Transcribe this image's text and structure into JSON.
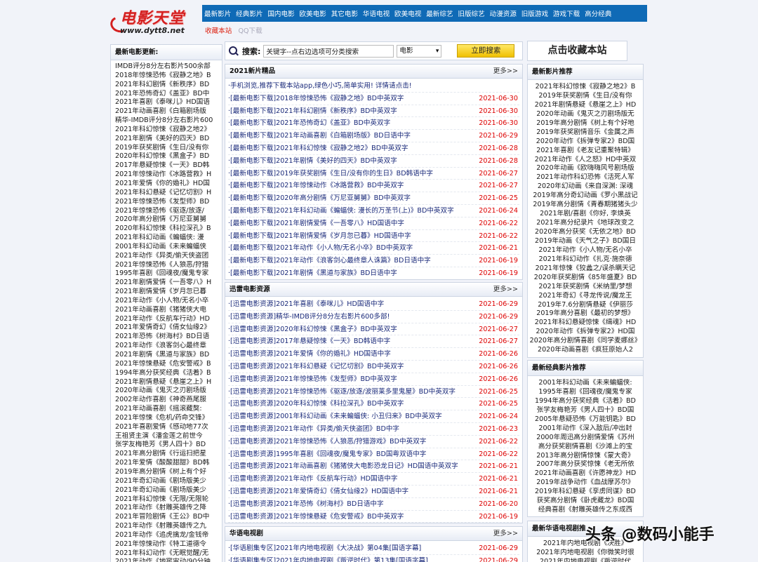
{
  "logo": {
    "cn": "电影天堂",
    "url": "www.dytt8.net"
  },
  "nav": [
    "最新影片",
    "经典影片",
    "国内电影",
    "欧美电影",
    "其它电影",
    "华语电视",
    "欧美电视",
    "最新综艺",
    "旧版综艺",
    "动漫资源",
    "旧版游戏",
    "游戏下载",
    "高分经典"
  ],
  "subnav": {
    "fav": "收藏本站",
    "qq": "QQ下载"
  },
  "left": {
    "title": "最新电影更新:",
    "items": [
      "IMDB评分8分左右影片500余部",
      "2018年惊悚恐怖《寂静之地》B",
      "2021年科幻剧情《新秩序》BD",
      "2021年恐怖奇幻《盖亚》BD中",
      "2021年喜剧《泰咪儿》HD国语",
      "2021年动画喜剧《白箱剧场版",
      "精华-IMDB评分8分左右影片600",
      "2021年科幻惊悚《寂静之地2》",
      "2021年剧情《美好的四天》BD",
      "2019年获奖剧情《生日/没有你",
      "2020年科幻惊悚《黑盒子》BD",
      "2017年悬疑惊悚《一天》BD韩",
      "2021年惊悚动作《冰路营救》H",
      "2021年爱情《你的婚礼》HD国",
      "2021年科幻悬疑《记忆切割》H",
      "2021年惊悚恐怖《发型师》BD",
      "2021年惊悚恐怖《驱逐/放逐/",
      "2020年高分剧情《万尼亚舅舅",
      "2020年科幻惊悚《科拉深孔》B",
      "2021年科幻动画《蝙蝠侠: 漫",
      "2001年科幻动画《未来蝙蝠侠",
      "2021年动作《异类/偷天侠盗团",
      "2021年惊悚恐怖《人狼恶/狩猎",
      "1995年喜剧《回魂夜/魔鬼专家",
      "2021年剧情爱情《一吾零八》H",
      "2021年剧情爱情《岁月忽已暮",
      "2021年动作《小人物/无名小卒",
      "2021年动画喜剧《猪猪侠大电",
      "2021年动作《反航车行动》HD",
      "2021年爱情奇幻《倩女仙缘2》",
      "2021年恐怖《树海村》BD日语",
      "2021年动作《浪客剑心最终章",
      "2021年剧情《黑道与家族》BD",
      "2021年惊悚悬疑《危安警戒》B",
      "1994年高分获奖经典《活着》B",
      "2021年剧情悬疑《悬崖之上》H",
      "2020年动画《鬼灭之刃剧场版",
      "2002年动作喜剧《神奇燕尾服",
      "2021年动画喜剧《摇滚藏獒:",
      "2021年惊悚《危机/药命交锋》",
      "2021年喜剧爱情《感动地77次",
      "王祖贤主演《潘金莲之前世今",
      "张学友梅艳芳《男人四十》BD",
      "2021年高分剧情《行运扫把星",
      "2021年爱情《酸酸甜甜》BD韩",
      "2019年高分剧情《树上有个好",
      "2021年奇幻动画《剧场版美少",
      "2021年奇幻动画《剧场版美少",
      "2021年科幻惊悚《无限/无限轮",
      "2021年动作《射雕英雄传之降",
      "2021年冒险剧情《王公》BD中",
      "2021年动作《射雕英雄传之九",
      "2021年动作《追虎擒龙/金钱帝",
      "2021年惊悚动作《特工道德令",
      "2021年科幻动作《无眠觉醒/无",
      "2021年动作《地窖宙动/90分钟"
    ]
  },
  "search": {
    "label": "搜索:",
    "input": "关键字--点右边选项可分类搜索",
    "select": "电影",
    "button": "立即搜索"
  },
  "fav_button": "点击收藏本站",
  "box1": {
    "title": "2021新片精品",
    "more": "更多>>",
    "notice": "·手机浏览,推荐下载本站app,绿色小巧,简单实用! 详情请点击!",
    "rows": [
      {
        "t": "·[最新电影下载]2018年惊悚恐怖《寂静之地》BD中英双字",
        "d": "2021-06-30"
      },
      {
        "t": "·[最新电影下载]2021年科幻剧情《新秩序》BD中英双字",
        "d": "2021-06-30"
      },
      {
        "t": "·[最新电影下载]2021年恐怖奇幻《盖亚》BD中英双字",
        "d": "2021-06-30"
      },
      {
        "t": "·[最新电影下载]2021年动画喜剧《白箱剧场版》BD日语中字",
        "d": "2021-06-29"
      },
      {
        "t": "·[最新电影下载]2021年科幻惊悚《寂静之地2》BD中英双字",
        "d": "2021-06-28"
      },
      {
        "t": "·[最新电影下载]2021年剧情《美好的四天》BD中英双字",
        "d": "2021-06-28"
      },
      {
        "t": "·[最新电影下载]2019年获奖剧情《生日/没有你的生日》BD韩语中字",
        "d": "2021-06-27"
      },
      {
        "t": "·[最新电影下载]2021年惊悚动作《冰路营救》BD中英双字",
        "d": "2021-06-27"
      },
      {
        "t": "·[最新电影下载]2020年高分剧情《万尼亚舅舅》BD中英双字",
        "d": "2021-06-25"
      },
      {
        "t": "·[最新电影下载]2021年科幻动画《蝙蝠侠: 漫长的万圣节(上)》BD中英双字",
        "d": "2021-06-24"
      },
      {
        "t": "·[最新电影下载]2021年剧情爱情《一吾零八》HD国语中字",
        "d": "2021-06-22"
      },
      {
        "t": "·[最新电影下载]2021年剧情爱情《岁月忽已暮》HD国语中字",
        "d": "2021-06-22"
      },
      {
        "t": "·[最新电影下载]2021年动作《小人物/无名小卒》BD中英双字",
        "d": "2021-06-21"
      },
      {
        "t": "·[最新电影下载]2021年动作《浪客剑心最终章人诛篇》BD日语中字",
        "d": "2021-06-19"
      },
      {
        "t": "·[最新电影下载]2021年剧情《黑道与家族》BD日语中字",
        "d": "2021-06-19"
      }
    ]
  },
  "box2": {
    "title": "迅雷电影资源",
    "more": "更多>>",
    "rows": [
      {
        "t": "·[迅雷电影资源]2021年喜剧《泰咪儿》HD国语中字",
        "d": "2021-06-29"
      },
      {
        "t": "·[迅雷电影资源]精华-IMDB评分8分左右影片600多部!",
        "d": "2021-06-29"
      },
      {
        "t": "·[迅雷电影资源]2020年科幻惊悚《黑盒子》BD中英双字",
        "d": "2021-06-27"
      },
      {
        "t": "·[迅雷电影资源]2017年悬疑惊悚《一天》BD韩语中字",
        "d": "2021-06-27"
      },
      {
        "t": "·[迅雷电影资源]2021年爱情《你的婚礼》HD国语中字",
        "d": "2021-06-26"
      },
      {
        "t": "·[迅雷电影资源]2021年科幻悬疑《记忆切割》BD中英双字",
        "d": "2021-06-26"
      },
      {
        "t": "·[迅雷电影资源]2021年惊悚恐怖《发型师》BD中英双字",
        "d": "2021-06-26"
      },
      {
        "t": "·[迅雷电影资源]2021年惊悚恐怖《驱逐/放逐/波丽莱多里鬼屋》BD中英双字",
        "d": "2021-06-25"
      },
      {
        "t": "·[迅雷电影资源]2020年科幻惊悚《科拉深孔》BD中英双字",
        "d": "2021-06-25"
      },
      {
        "t": "·[迅雷电影资源]2001年科幻动画《未来蝙蝠侠: 小丑归来》BD中英双字",
        "d": "2021-06-24"
      },
      {
        "t": "·[迅雷电影资源]2021年动作《异类/偷天侠盗团》BD中字",
        "d": "2021-06-23"
      },
      {
        "t": "·[迅雷电影资源]2021年惊悚恐怖《人狼恶/狩猎游戏》BD中英双字",
        "d": "2021-06-22"
      },
      {
        "t": "·[迅雷电影资源]1995年喜剧《回魂夜/魔鬼专家》BD国粤双语中字",
        "d": "2021-06-22"
      },
      {
        "t": "·[迅雷电影资源]2021年动画喜剧《猪猪侠大电影恐龙日记》HD国语中英双字",
        "d": "2021-06-21"
      },
      {
        "t": "·[迅雷电影资源]2021年动作《反航车行动》HD国语中字",
        "d": "2021-06-21"
      },
      {
        "t": "·[迅雷电影资源]2021年爱情奇幻《倩女仙缘2》HD国语中字",
        "d": "2021-06-21"
      },
      {
        "t": "·[迅雷电影资源]2021年恐怖《树海村》BD日语中字",
        "d": "2021-06-20"
      },
      {
        "t": "·[迅雷电影资源]2021年惊悚悬疑《危安警戒》BD中英双字",
        "d": "2021-06-19"
      }
    ]
  },
  "box3": {
    "title": "华语电视剧",
    "more": "更多>>",
    "rows": [
      {
        "t": "·[华语剧集专区]2021年内地电视剧《大决战》第04集[国语字幕]",
        "d": "2021-06-29"
      },
      {
        "t": "·[华语剧集专区]2021年内地电视剧《叛逆时代》第13集[国语字幕]",
        "d": "2021-06-29"
      }
    ]
  },
  "right1": {
    "title": "最新影片推荐",
    "items": [
      "2021年科幻惊悚《寂静之地2》B",
      "2019年获奖剧情《生日/没有你",
      "2021年剧情悬疑《悬崖之上》HD",
      "2020年动画《鬼灭之刃剧场版无",
      "2019年高分剧情《树上有个好地",
      "2019年获奖剧情音乐《金属之声",
      "2020年动作《拆弹专家2》BD国",
      "2021年喜剧《老友记重聚特辑》",
      "2021年动作《人之怒》HD中英双",
      "2020年动画《欧嗨嗨风号剧场版",
      "2021年动作科幻恐怖《活死人军",
      "2020年幻动画《来自深渊: 深魂",
      "2019年高分奇幻动画《罗小黑战记",
      "2019年高分剧情《青春期猪猪头少",
      "2021年剧/喜剧《你好, 李焕英",
      "2021年高分纪录片《地球改变之",
      "2020年高分获奖《无依之地》BD",
      "2019年动画《天气之子》BD国日",
      "2021年动作《小人物/无名小卒",
      "2021年科幻动作《扎克·施奈德",
      "2021年惊悚《狡蠡之/误杀瞒天记",
      "2020年获奖剧情《85年盛夏》BD",
      "2021年获奖剧情《米纳里/梦想",
      "2021年奇幻《寻龙传说/魔龙王",
      "2019年7.6分剧情悬疑《伊丽莎",
      "2019年高分喜剧《最初的梦想》",
      "2021年科幻悬疑惊悚《缉魂》HD",
      "2020年动作《拆弹专家2》HD国",
      "2020年高分剧情喜剧《同学麦娜丝》",
      "2020年动画喜剧《疯狂原始人2"
    ]
  },
  "right2": {
    "title": "最新经典影片推荐",
    "items": [
      "2001年科幻动画《未来蝙蝠侠:",
      "1995年喜剧《回魂夜/魔鬼专家",
      "1994年高分获奖经典《活着》BD",
      "张学友梅艳芳《男人四十》BD国",
      "2005年悬疑恐怖《万能钥匙》BD",
      "2001年动作《深入敌后/冲出封",
      "2000年周迅高分剧情爱情《苏州",
      "高分获奖剧情喜剧《沙滩上的宝",
      "2013年高分剧情惊悚《蒙大奇》",
      "2007年高分获奖惊悚《老无所依",
      "2021年动画喜剧《许愿神龙》HD",
      "2019年战争动作《血战摩苏尔》",
      "2019年科幻悬疑《孪虏同谋》BD",
      "获奖高分剧情《卧虎藏龙》BD国",
      "经典喜剧《射雕英雄传之东成西"
    ]
  },
  "right3": {
    "title": "最新华语电视剧推",
    "items": [
      "2021年内地电视剧《决胜》",
      "2021年内地电视剧《你微笑时很",
      "2021年内地电视剧《叛逆时代"
    ]
  },
  "watermark": "头条 @数码小能手"
}
